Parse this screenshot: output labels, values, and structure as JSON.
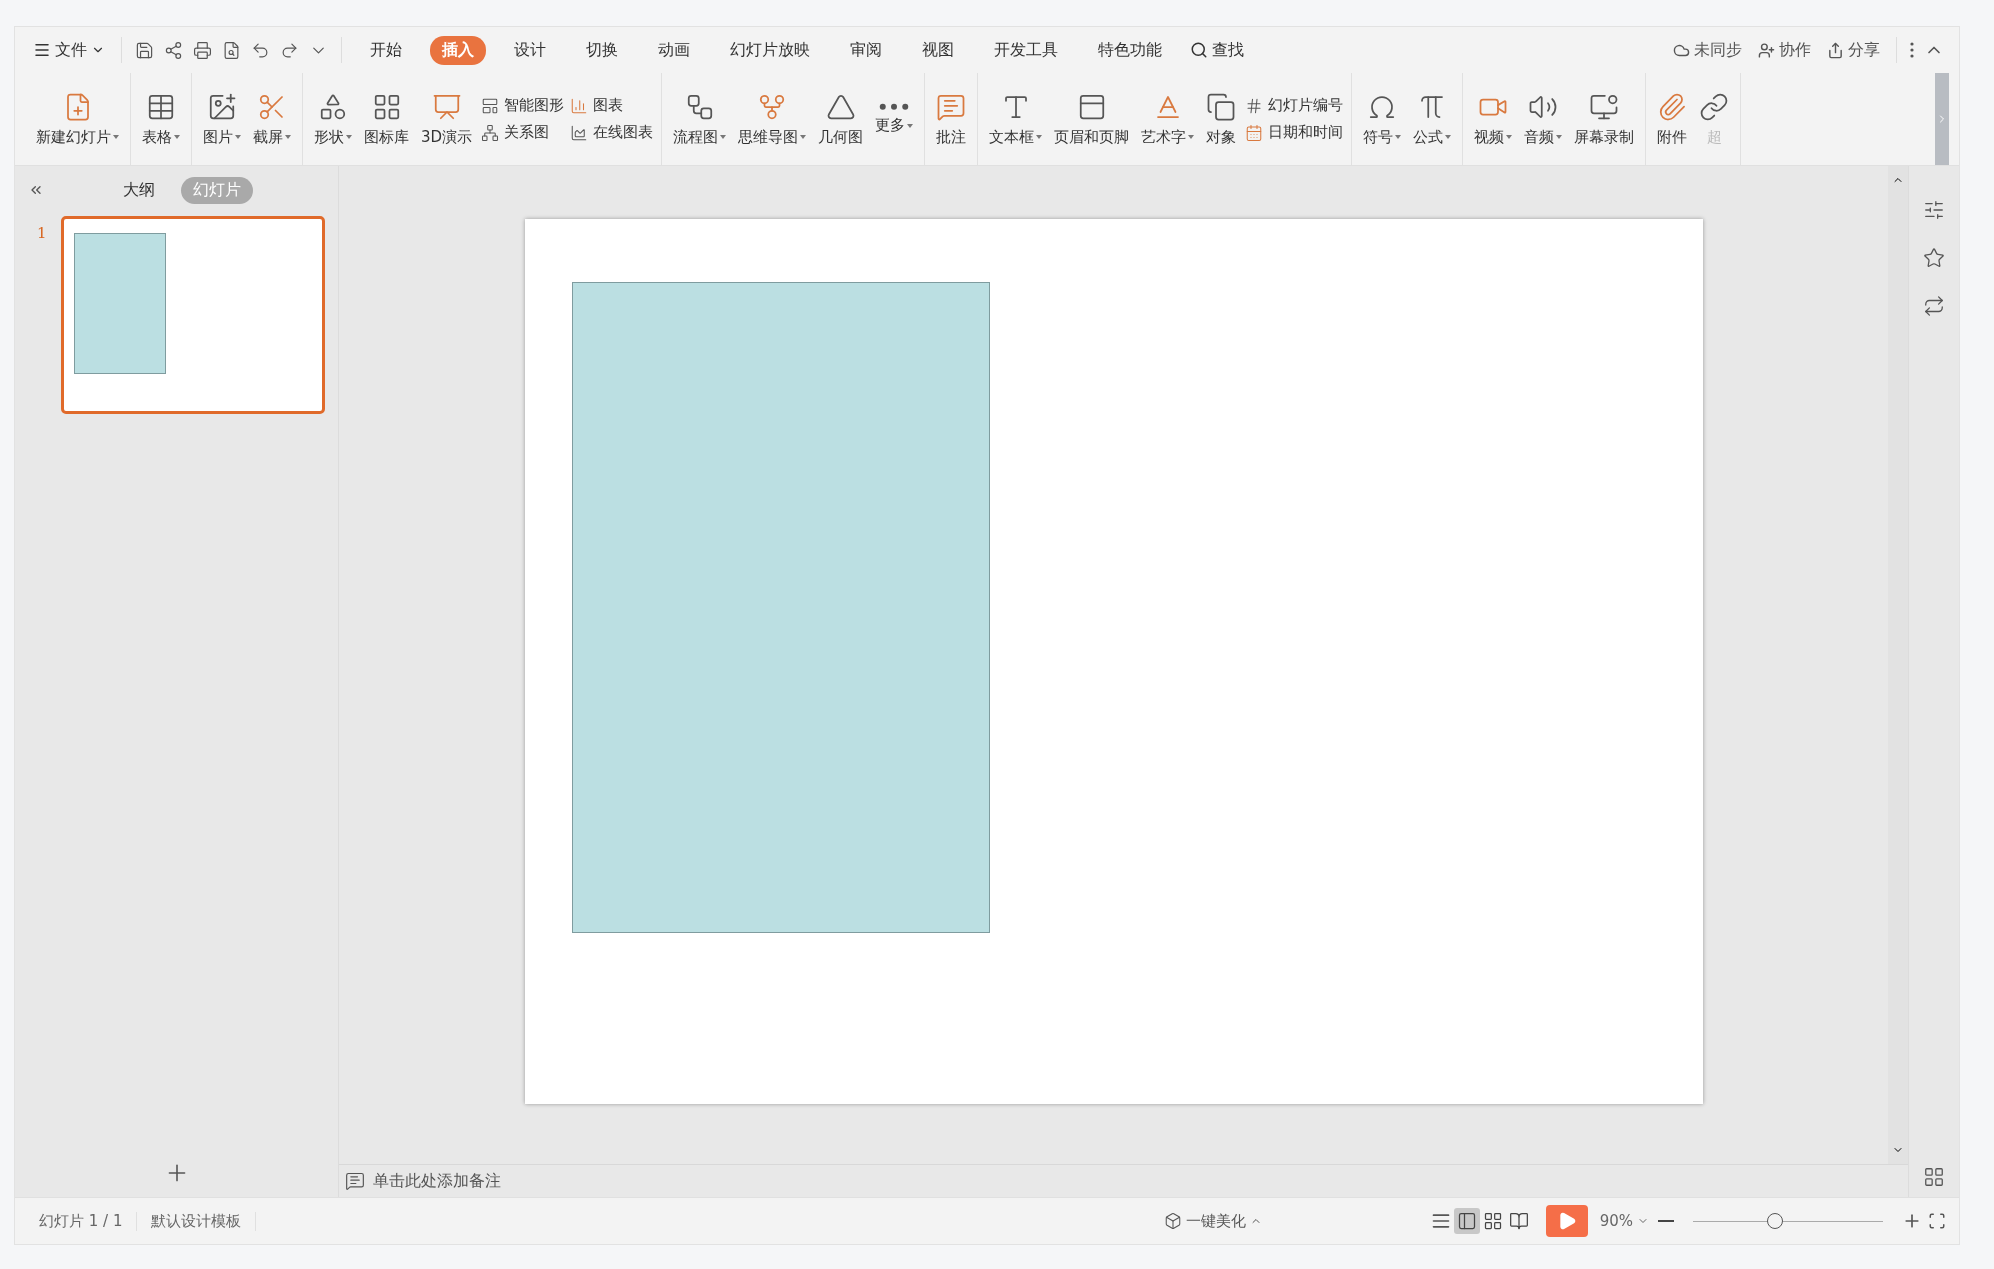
{
  "menu": {
    "file": "文件",
    "tabs": [
      {
        "label": "开始",
        "selected": false
      },
      {
        "label": "插入",
        "selected": true
      },
      {
        "label": "设计",
        "selected": false
      },
      {
        "label": "切换",
        "selected": false
      },
      {
        "label": "动画",
        "selected": false
      },
      {
        "label": "幻灯片放映",
        "selected": false
      },
      {
        "label": "审阅",
        "selected": false
      },
      {
        "label": "视图",
        "selected": false
      },
      {
        "label": "开发工具",
        "selected": false
      },
      {
        "label": "特色功能",
        "selected": false
      }
    ],
    "search": "查找",
    "actions": [
      "未同步",
      "协作",
      "分享"
    ]
  },
  "ribbon": [
    [
      {
        "kind": "big",
        "label": "新建幻灯片",
        "caret": true
      }
    ],
    [
      {
        "kind": "big",
        "label": "表格",
        "caret": true
      }
    ],
    [
      {
        "kind": "big",
        "label": "图片",
        "caret": true
      },
      {
        "kind": "big",
        "label": "截屏",
        "caret": true
      }
    ],
    [
      {
        "kind": "big",
        "label": "形状",
        "caret": true
      },
      {
        "kind": "big",
        "label": "图标库",
        "caret": false
      },
      {
        "kind": "big",
        "label": "3D演示",
        "caret": false
      },
      {
        "kind": "pair",
        "items": [
          "智能图形",
          "关系图"
        ]
      },
      {
        "kind": "pair",
        "items": [
          "图表",
          "在线图表"
        ]
      }
    ],
    [
      {
        "kind": "big",
        "label": "流程图",
        "caret": true
      },
      {
        "kind": "big",
        "label": "思维导图",
        "caret": true
      },
      {
        "kind": "big",
        "label": "几何图",
        "caret": false
      },
      {
        "kind": "big",
        "label": "更多",
        "caret": true
      }
    ],
    [
      {
        "kind": "big",
        "label": "批注",
        "caret": false
      }
    ],
    [
      {
        "kind": "big",
        "label": "文本框",
        "caret": true
      },
      {
        "kind": "big",
        "label": "页眉和页脚",
        "caret": false
      },
      {
        "kind": "big",
        "label": "艺术字",
        "caret": true
      },
      {
        "kind": "big",
        "label": "对象",
        "caret": false
      },
      {
        "kind": "pair",
        "items": [
          "幻灯片编号",
          "日期和时间"
        ]
      }
    ],
    [
      {
        "kind": "big",
        "label": "符号",
        "caret": true
      },
      {
        "kind": "big",
        "label": "公式",
        "caret": true
      }
    ],
    [
      {
        "kind": "big",
        "label": "视频",
        "caret": true
      },
      {
        "kind": "big",
        "label": "音频",
        "caret": true
      },
      {
        "kind": "big",
        "label": "屏幕录制",
        "caret": false
      }
    ],
    [
      {
        "kind": "big",
        "label": "附件",
        "caret": false
      },
      {
        "kind": "big",
        "label": "超",
        "caret": false
      }
    ]
  ],
  "panel": {
    "tabs": [
      {
        "label": "大纲",
        "selected": false
      },
      {
        "label": "幻灯片",
        "selected": true
      }
    ],
    "slides": [
      {
        "number": "1",
        "selected": true
      }
    ]
  },
  "slide": {
    "shapes": [
      {
        "kind": "rectangle"
      }
    ]
  },
  "notes": {
    "placeholder": "单击此处添加备注"
  },
  "status_bar": {
    "slide": "幻灯片 1 / 1",
    "template": "默认设计模板",
    "beautify": "一键美化",
    "views": [
      {
        "kind": "normal",
        "selected": true
      },
      {
        "kind": "sorter",
        "selected": false
      },
      {
        "kind": "reading",
        "selected": false
      }
    ],
    "zoom": "90%",
    "zoom_slider": {
      "level": 0.43
    }
  }
}
